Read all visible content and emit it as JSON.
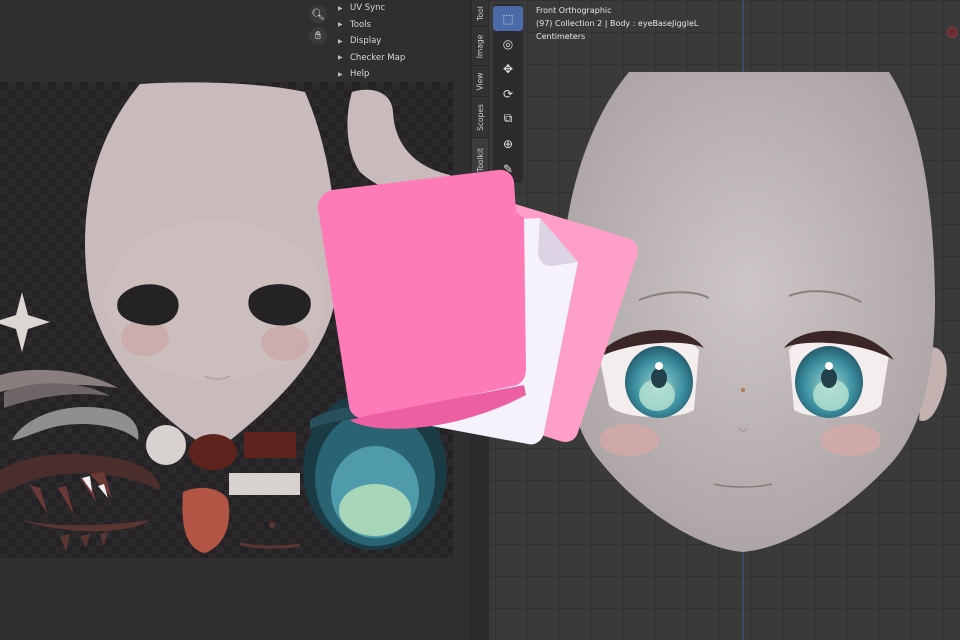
{
  "uv_editor": {
    "panel_menu": [
      {
        "label": "UV Sync"
      },
      {
        "label": "Tools"
      },
      {
        "label": "Display"
      },
      {
        "label": "Checker Map"
      },
      {
        "label": "Help"
      }
    ],
    "nav_icons": [
      "zoom-icon",
      "hand-pan-icon"
    ],
    "sidebar_tabs": [
      "Tool",
      "Image",
      "View",
      "Scopes",
      "UV Toolkit"
    ]
  },
  "viewport": {
    "view_name": "Front Orthographic",
    "collection_info": "(97) Collection 2 | Body : eyeBaseJiggleL",
    "units": "Centimeters",
    "tools": [
      "select-box-icon",
      "cursor-icon",
      "move-icon",
      "rotate-icon",
      "scale-icon",
      "transform-icon",
      "annotate-icon"
    ]
  },
  "overlay": {
    "icon": "files-icon",
    "colors": {
      "front_page": "#ff7bb8",
      "back_page": "#ff9ec8",
      "middle_page": "#f6f2fb"
    }
  },
  "colors": {
    "active_tool": "#4a6ba8",
    "skin": "#c9bbbb",
    "eye_teal": "#3b8fa0"
  }
}
